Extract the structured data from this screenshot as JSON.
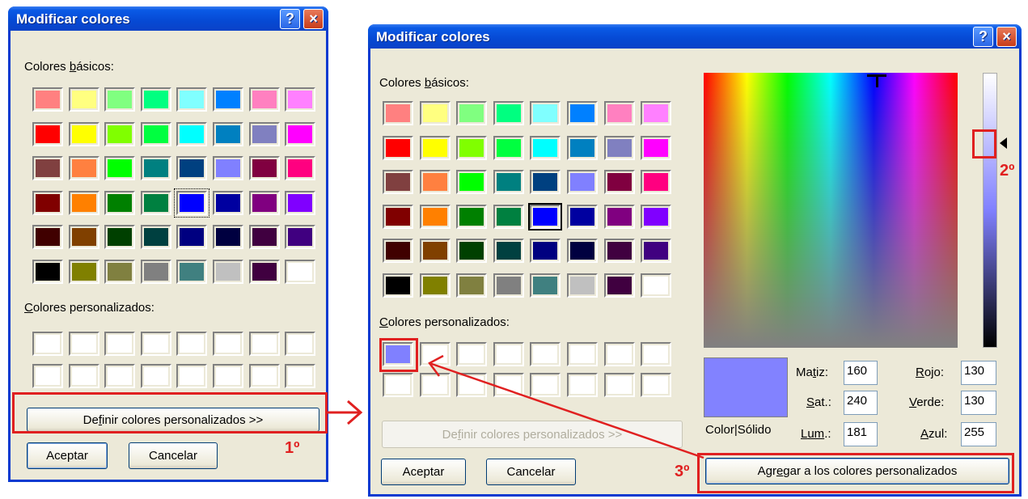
{
  "left_dialog": {
    "title": "Modificar colores",
    "help_glyph": "?",
    "close_glyph": "×",
    "basic_colors_label_pre": "Colores ",
    "basic_colors_label_u": "b",
    "basic_colors_label_post": "ásicos:",
    "custom_colors_label_u": "C",
    "custom_colors_label_post": "olores personalizados:",
    "define_button_pre": "De",
    "define_button_u": "f",
    "define_button_post": "inir colores personalizados >>",
    "accept_label": "Aceptar",
    "cancel_label": "Cancelar"
  },
  "right_dialog": {
    "title": "Modificar colores",
    "help_glyph": "?",
    "close_glyph": "×",
    "basic_colors_label_pre": "Colores ",
    "basic_colors_label_u": "b",
    "basic_colors_label_post": "ásicos:",
    "custom_colors_label_u": "C",
    "custom_colors_label_post": "olores personalizados:",
    "define_button_pre": "De",
    "define_button_u": "f",
    "define_button_post": "inir colores personalizados >>",
    "accept_label": "Aceptar",
    "cancel_label": "Cancelar",
    "color_solid_label": "Color|Sólido",
    "hue_label_pre": "Ma",
    "hue_label_u": "t",
    "hue_label_post": "iz:",
    "hue_value": "160",
    "sat_label_u": "S",
    "sat_label_post": "at.:",
    "sat_value": "240",
    "lum_label_u": "L",
    "lum_label_mid": "um",
    "lum_label_post": ".:",
    "lum_value": "181",
    "red_label_u": "R",
    "red_label_post": "ojo:",
    "red_value": "130",
    "green_label_u": "V",
    "green_label_post": "erde:",
    "green_value": "130",
    "blue_label_u": "A",
    "blue_label_post": "zul:",
    "blue_value": "255",
    "add_button_pre": "Agr",
    "add_button_u": "e",
    "add_button_post": "gar a los colores personalizados",
    "current_color": "#8282ff"
  },
  "basic_colors": [
    [
      "#ff8080",
      "#ffff80",
      "#80ff80",
      "#00ff80",
      "#80ffff",
      "#0080ff",
      "#ff80c0",
      "#ff80ff"
    ],
    [
      "#ff0000",
      "#ffff00",
      "#80ff00",
      "#00ff40",
      "#00ffff",
      "#0080c0",
      "#8080c0",
      "#ff00ff"
    ],
    [
      "#804040",
      "#ff8040",
      "#00ff00",
      "#008080",
      "#004080",
      "#8080ff",
      "#800040",
      "#ff0080"
    ],
    [
      "#800000",
      "#ff8000",
      "#008000",
      "#008040",
      "#0000ff",
      "#0000a0",
      "#800080",
      "#8000ff"
    ],
    [
      "#400000",
      "#804000",
      "#004000",
      "#004040",
      "#000080",
      "#000040",
      "#400040",
      "#400080"
    ],
    [
      "#000000",
      "#808000",
      "#808040",
      "#808080",
      "#408080",
      "#c0c0c0",
      "#400040",
      "#ffffff"
    ]
  ],
  "custom_colors_left": [
    "#ffffff",
    "#ffffff",
    "#ffffff",
    "#ffffff",
    "#ffffff",
    "#ffffff",
    "#ffffff",
    "#ffffff",
    "#ffffff",
    "#ffffff",
    "#ffffff",
    "#ffffff",
    "#ffffff",
    "#ffffff",
    "#ffffff",
    "#ffffff"
  ],
  "custom_colors_right": [
    "#8080ff",
    "#ffffff",
    "#ffffff",
    "#ffffff",
    "#ffffff",
    "#ffffff",
    "#ffffff",
    "#ffffff",
    "#ffffff",
    "#ffffff",
    "#ffffff",
    "#ffffff",
    "#ffffff",
    "#ffffff",
    "#ffffff",
    "#ffffff"
  ],
  "annotations": {
    "step1": "1º",
    "step2": "2º",
    "step3": "3º",
    "annotation_color": "#e02020"
  }
}
